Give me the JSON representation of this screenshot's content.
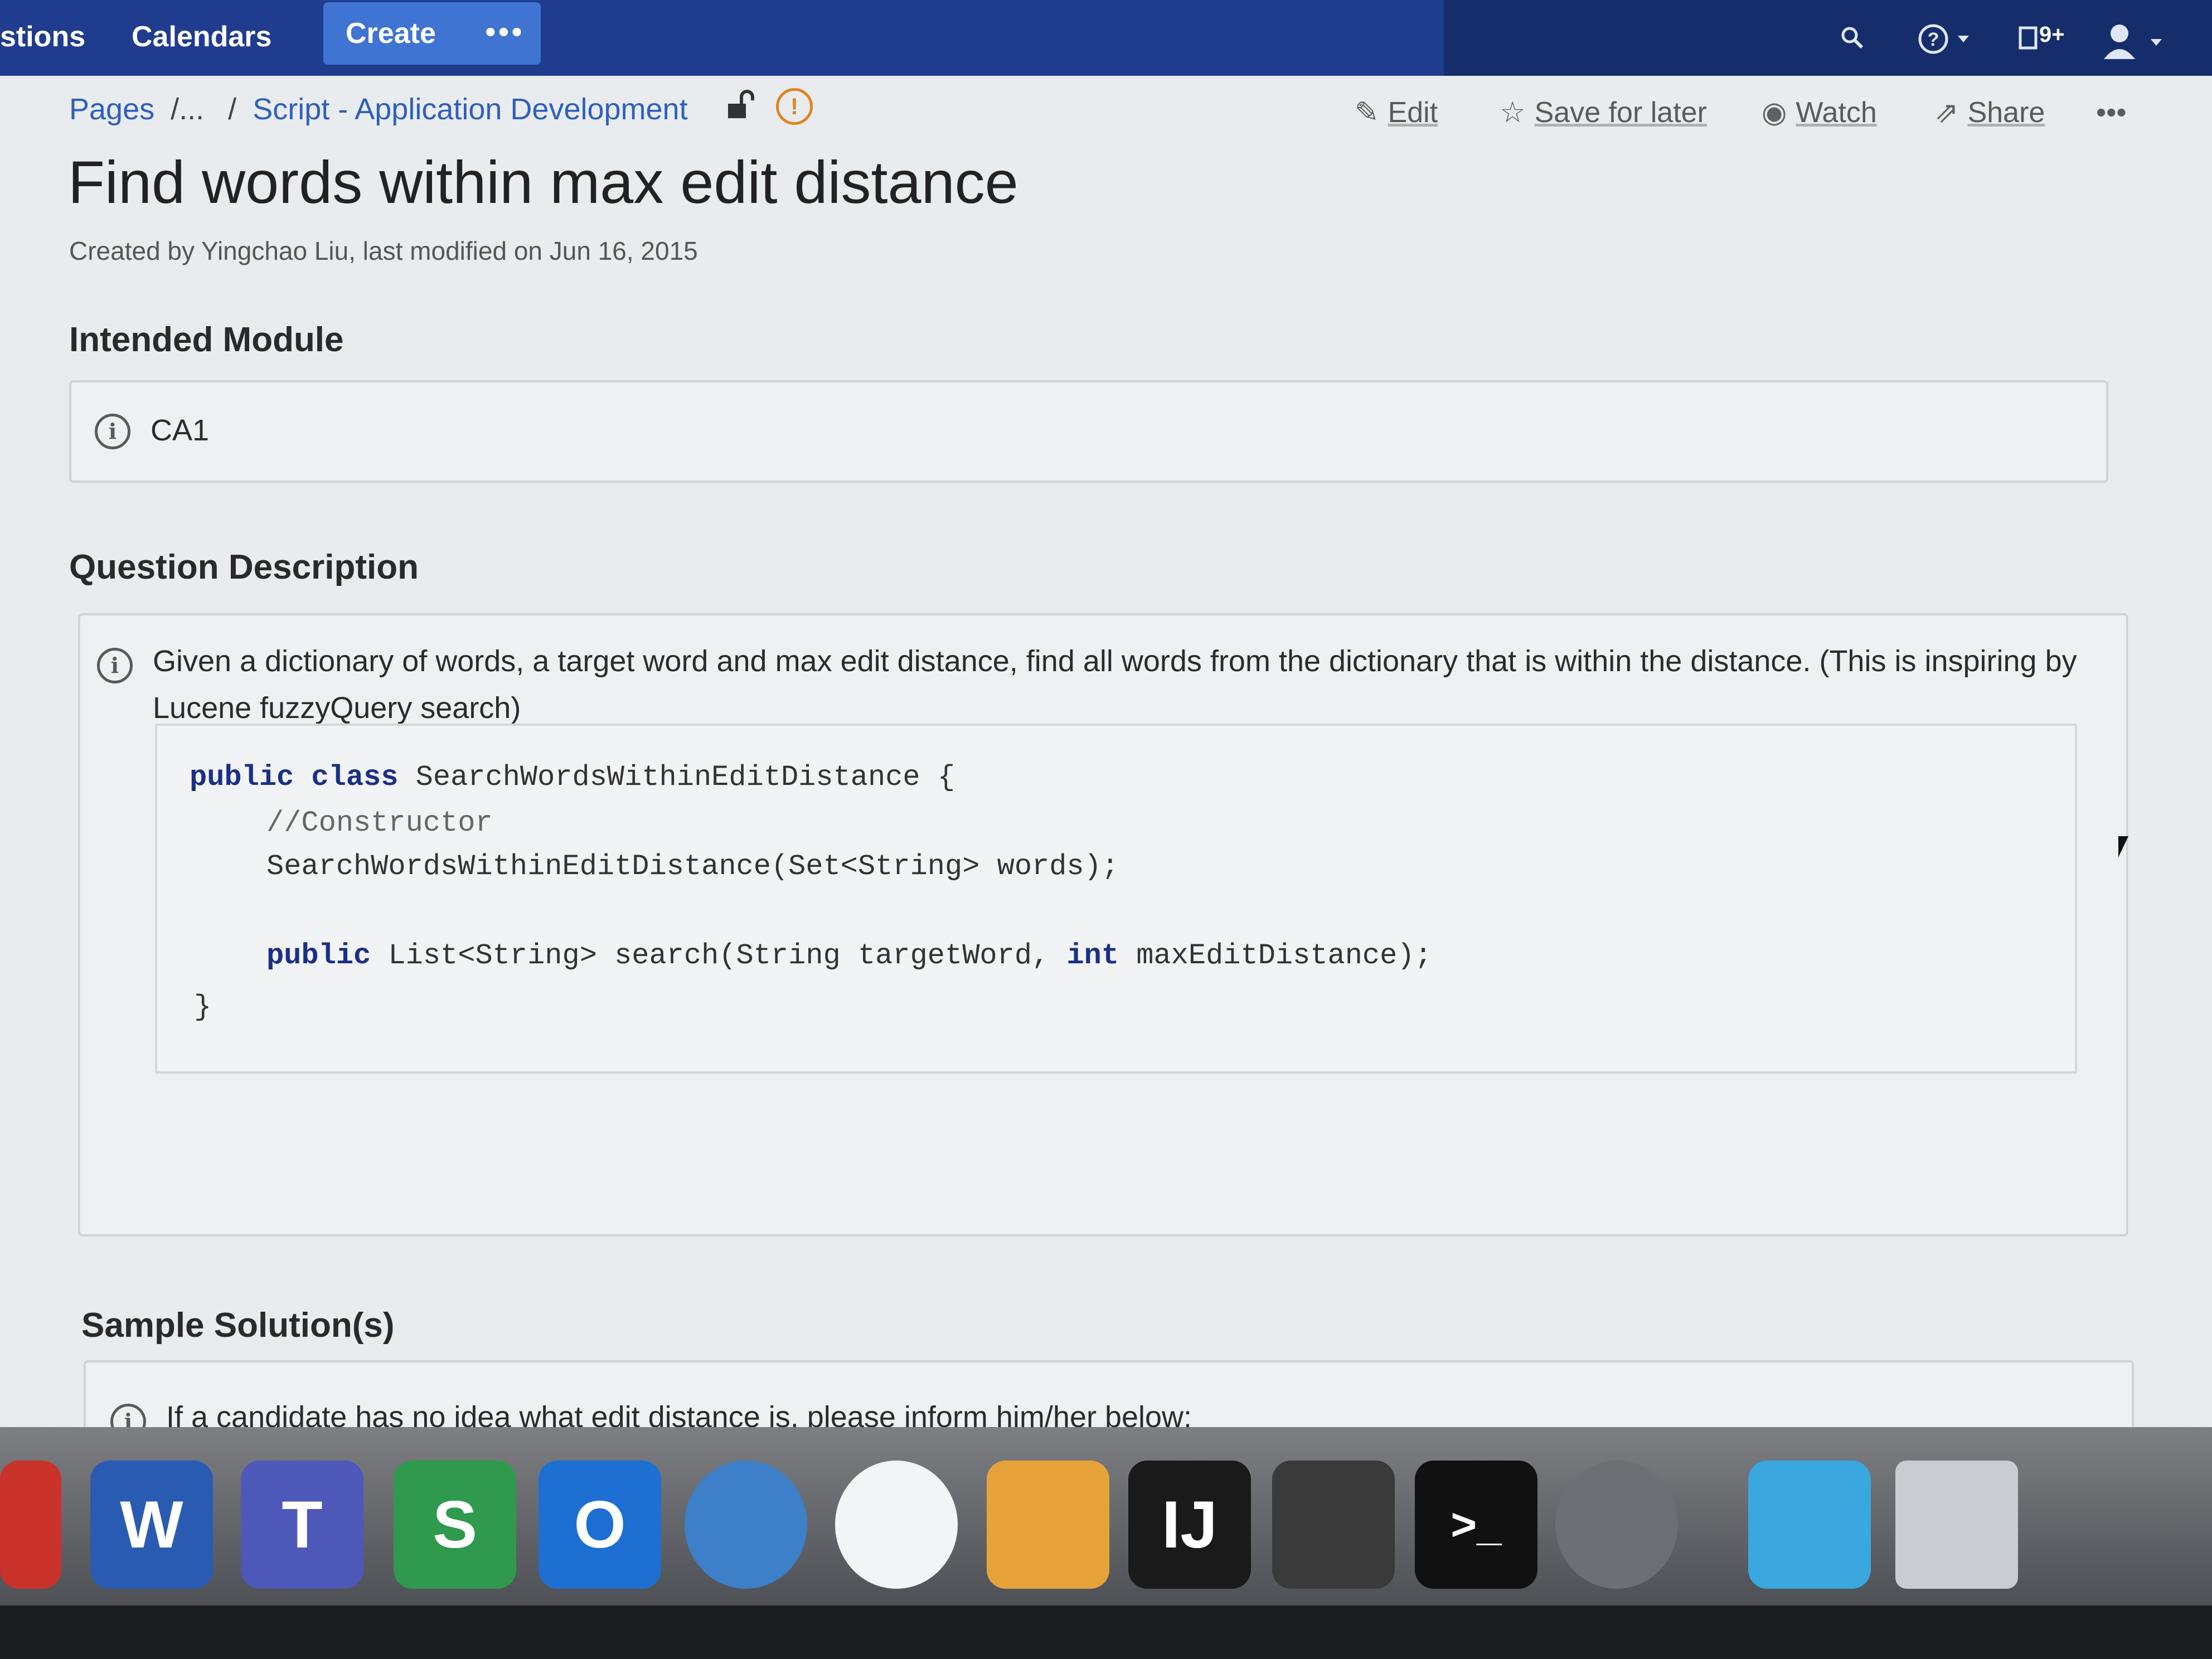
{
  "topbar": {
    "nav_partial": "stions",
    "calendars": "Calendars",
    "create": "Create",
    "more": "•••",
    "notifications_badge": "9+"
  },
  "breadcrumb": {
    "pages": "Pages",
    "ellipsis": "/...",
    "sep": "/",
    "parent": "Script - Application Development"
  },
  "actions": {
    "edit": "Edit",
    "save_for_later": "Save for later",
    "watch": "Watch",
    "share": "Share",
    "more": "•••"
  },
  "page": {
    "title": "Find words within max edit distance",
    "meta": "Created by Yingchao Liu, last modified on Jun 16, 2015"
  },
  "sections": {
    "intended_module": {
      "heading": "Intended Module",
      "value": "CA1"
    },
    "question_description": {
      "heading": "Question Description",
      "line1": "Given a dictionary of words, a target word and max edit distance, find all words from the dictionary that is within the distance. (This is inspiring by",
      "line2": "Lucene fuzzyQuery search)"
    },
    "sample_solutions": {
      "heading": "Sample Solution(s)",
      "note": "If a candidate has no idea what edit distance is, please inform him/her below:"
    }
  },
  "code": {
    "l1_kw": "public class",
    "l1_rest": " SearchWordsWithinEditDistance {",
    "l2": "//Constructor",
    "l3": "SearchWordsWithinEditDistance(Set<String> words);",
    "l4_kw1": "public",
    "l4_mid": " List<String> search(String targetWord, ",
    "l4_kw2": "int",
    "l4_rest": " maxEditDistance);",
    "l5": "}"
  },
  "dock": {
    "word": "W",
    "teams": "T",
    "skype": "S",
    "outlook": "O",
    "intellij": "IJ",
    "terminal": ">_"
  },
  "colors": {
    "topbar": "#1f3c8f",
    "create_button": "#3f74d2",
    "link": "#2f5fbd",
    "warning": "#e0851f"
  }
}
